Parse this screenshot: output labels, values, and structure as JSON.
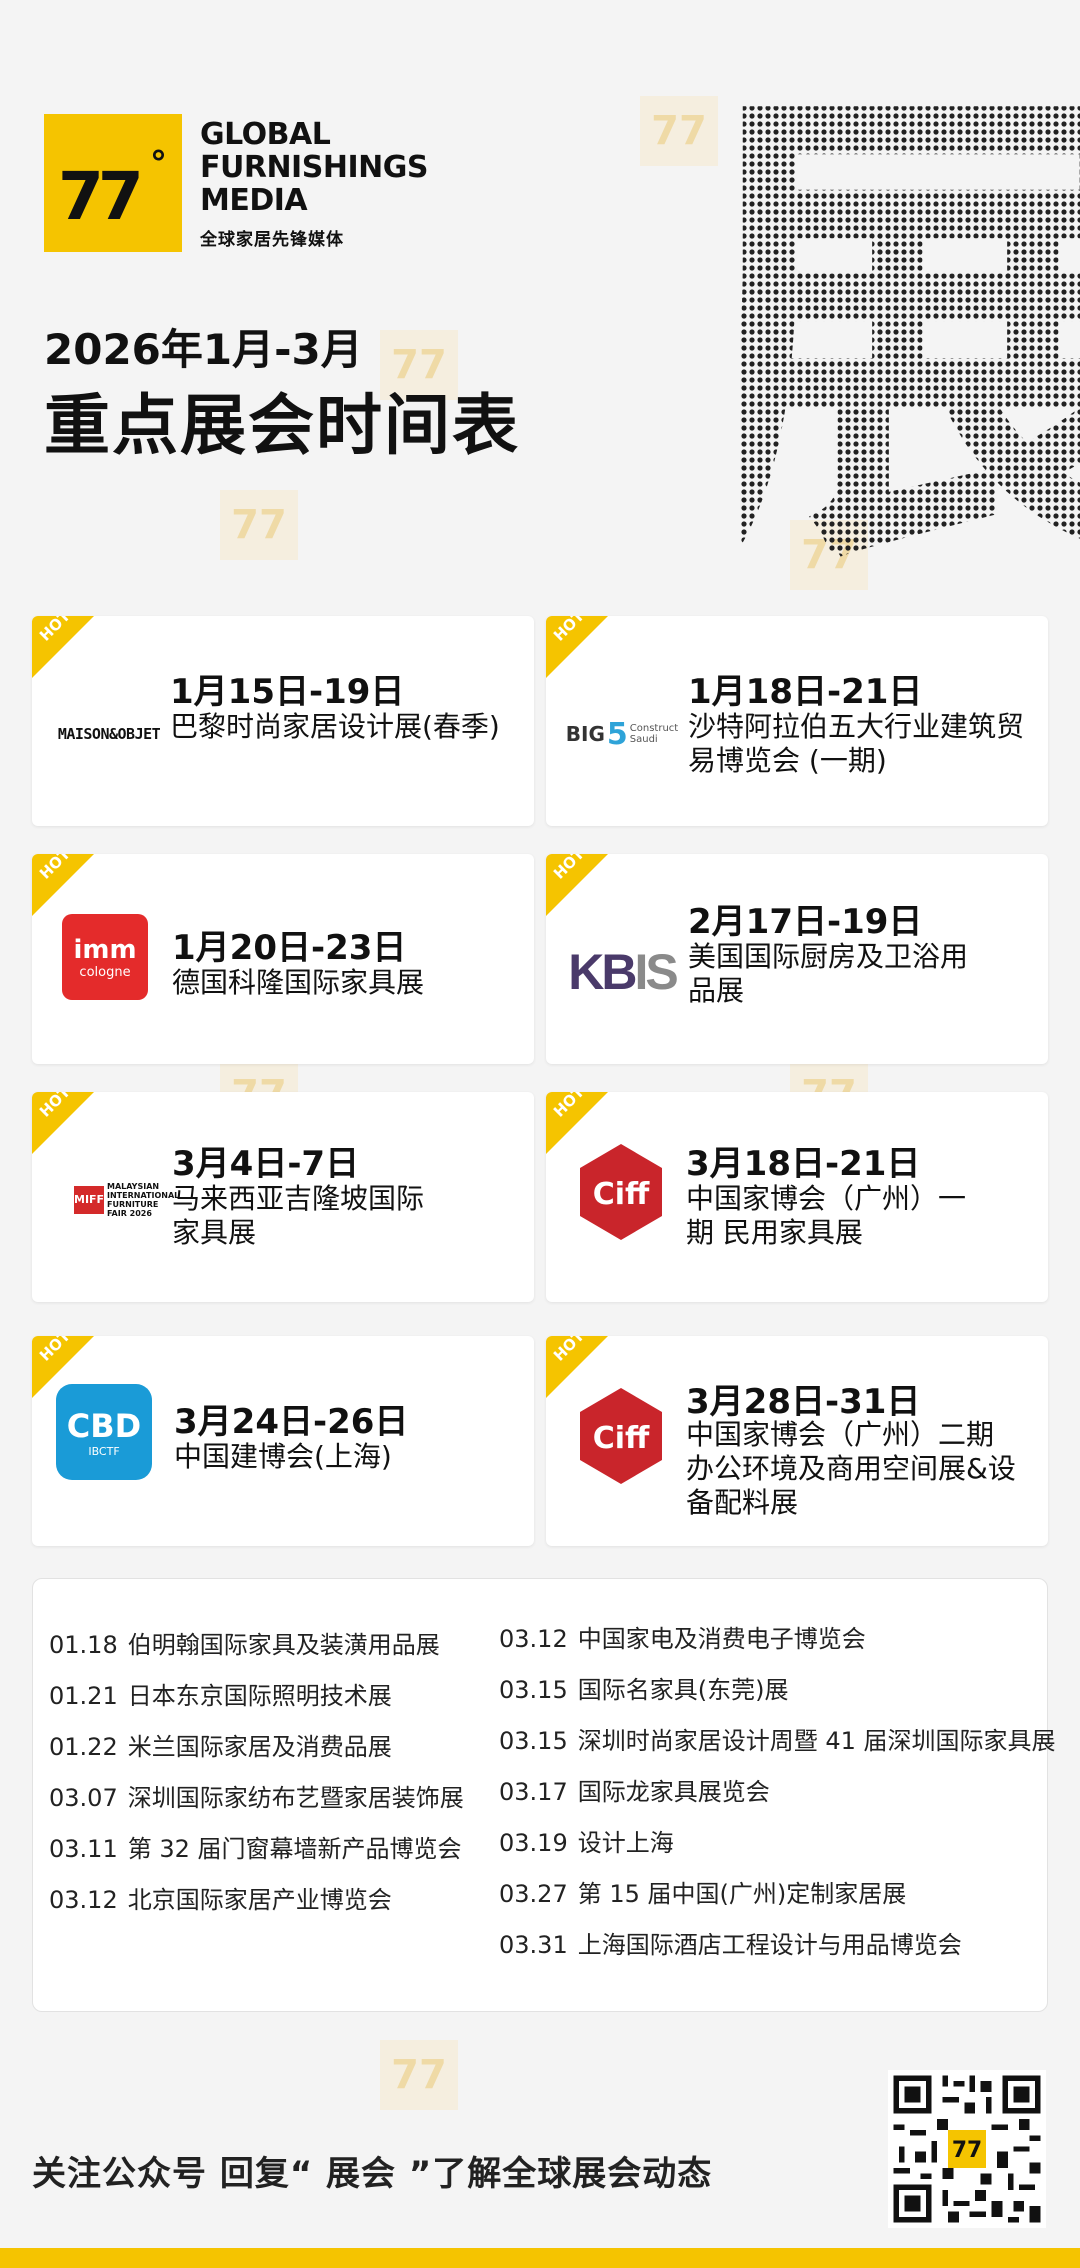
{
  "brand": {
    "logo_number": "77",
    "logo_degree": "°",
    "name_line1": "GLOBAL",
    "name_line2": "FURNISHINGS",
    "name_line3": "MEDIA",
    "name_cn": "全球家居先锋媒体",
    "accent_color": "#f5c400"
  },
  "header": {
    "subtitle": "2026年1月-3月",
    "title": "重点展会时间表",
    "decorative_char": "展"
  },
  "hot_badge": "HOT",
  "cards": [
    {
      "date": "1月15日-19日",
      "name": "巴黎时尚家居设计展(春季)",
      "logo": "MAISON&OBJET"
    },
    {
      "date": "1月18日-21日",
      "name": "沙特阿拉伯五大行业建筑贸易博览会 (一期)",
      "logo": "BIG 5 Construct Saudi"
    },
    {
      "date": "1月20日-23日",
      "name": "德国科隆国际家具展",
      "logo": "imm cologne"
    },
    {
      "date": "2月17日-19日",
      "name": "美国国际厨房及卫浴用品展",
      "logo": "KBIS"
    },
    {
      "date": "3月4日-7日",
      "name": "马来西亚吉隆坡国际家具展",
      "logo": "MIFF"
    },
    {
      "date": "3月18日-21日",
      "name": "中国家博会（广州）一期 民用家具展",
      "logo": "CIFF"
    },
    {
      "date": "3月24日-26日",
      "name": "中国建博会(上海)",
      "logo": "CBD IBCTF"
    },
    {
      "date": "3月28日-31日",
      "name": "中国家博会（广州）二期 办公环境及商用空间展&设备配料展",
      "logo": "CIFF"
    }
  ],
  "list_left": [
    {
      "date": "01.18",
      "name": "伯明翰国际家具及装潢用品展"
    },
    {
      "date": "01.21",
      "name": "日本东京国际照明技术展"
    },
    {
      "date": "01.22",
      "name": "米兰国际家居及消费品展"
    },
    {
      "date": "03.07",
      "name": "深圳国际家纺布艺暨家居装饰展"
    },
    {
      "date": "03.11",
      "name": "第 32 届门窗幕墙新产品博览会"
    },
    {
      "date": "03.12",
      "name": "北京国际家居产业博览会"
    }
  ],
  "list_right": [
    {
      "date": "03.12",
      "name": "中国家电及消费电子博览会"
    },
    {
      "date": "03.15",
      "name": "国际名家具(东莞)展"
    },
    {
      "date": "03.15",
      "name": "深圳时尚家居设计周暨 41 届深圳国际家具展"
    },
    {
      "date": "03.17",
      "name": "国际龙家具展览会"
    },
    {
      "date": "03.19",
      "name": "设计上海"
    },
    {
      "date": "03.27",
      "name": "第 15 届中国(广州)定制家居展"
    },
    {
      "date": "03.31",
      "name": "上海国际酒店工程设计与用品博览会"
    }
  ],
  "footer": {
    "text": "关注公众号  回复“ 展会 ”了解全球展会动态"
  }
}
